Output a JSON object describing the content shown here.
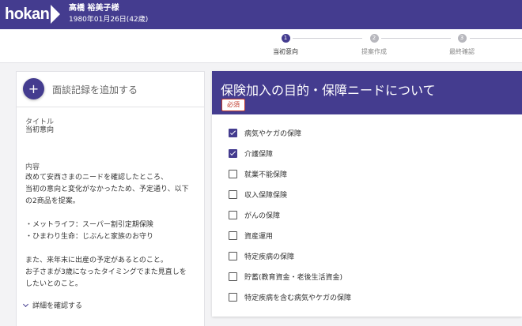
{
  "app": {
    "logo": "hokan"
  },
  "patient": {
    "name": "高橋 裕美子様",
    "dob": "1980年01月26日(42歳)"
  },
  "steps": [
    {
      "num": "1",
      "label": "当初意向",
      "active": true
    },
    {
      "num": "2",
      "label": "提案作成",
      "active": false
    },
    {
      "num": "3",
      "label": "最終確認",
      "active": false
    }
  ],
  "left": {
    "add_label": "面談記録を追加する",
    "title_label": "タイトル",
    "title_value": "当初意向",
    "content_label": "内容",
    "content_lines": [
      "改めて安西さまのニードを確認したところ、",
      "当初の意向と変化がなかったため、予定通り、以下",
      "の2商品を提案。",
      "",
      "・メットライフ：スーパー割引定期保険",
      "・ひまわり生命：じぶんと家族のお守り",
      "",
      "また、来年末に出産の予定があるとのこと。",
      "お子さまが3歳になったタイミングでまた見直しを",
      "したいとのこと。"
    ],
    "detail_link": "詳細を確認する"
  },
  "right": {
    "title": "保険加入の目的・保障ニードについて",
    "required": "必須",
    "options": [
      {
        "label": "病気やケガの保障",
        "checked": true
      },
      {
        "label": "介護保障",
        "checked": true
      },
      {
        "label": "就業不能保障",
        "checked": false
      },
      {
        "label": "収入保障保険",
        "checked": false
      },
      {
        "label": "がんの保障",
        "checked": false
      },
      {
        "label": "資産運用",
        "checked": false
      },
      {
        "label": "特定疾病の保障",
        "checked": false
      },
      {
        "label": "貯蓄(教育資金・老後生活資金)",
        "checked": false
      },
      {
        "label": "特定疾病を含む病気やケガの保障",
        "checked": false
      }
    ]
  }
}
